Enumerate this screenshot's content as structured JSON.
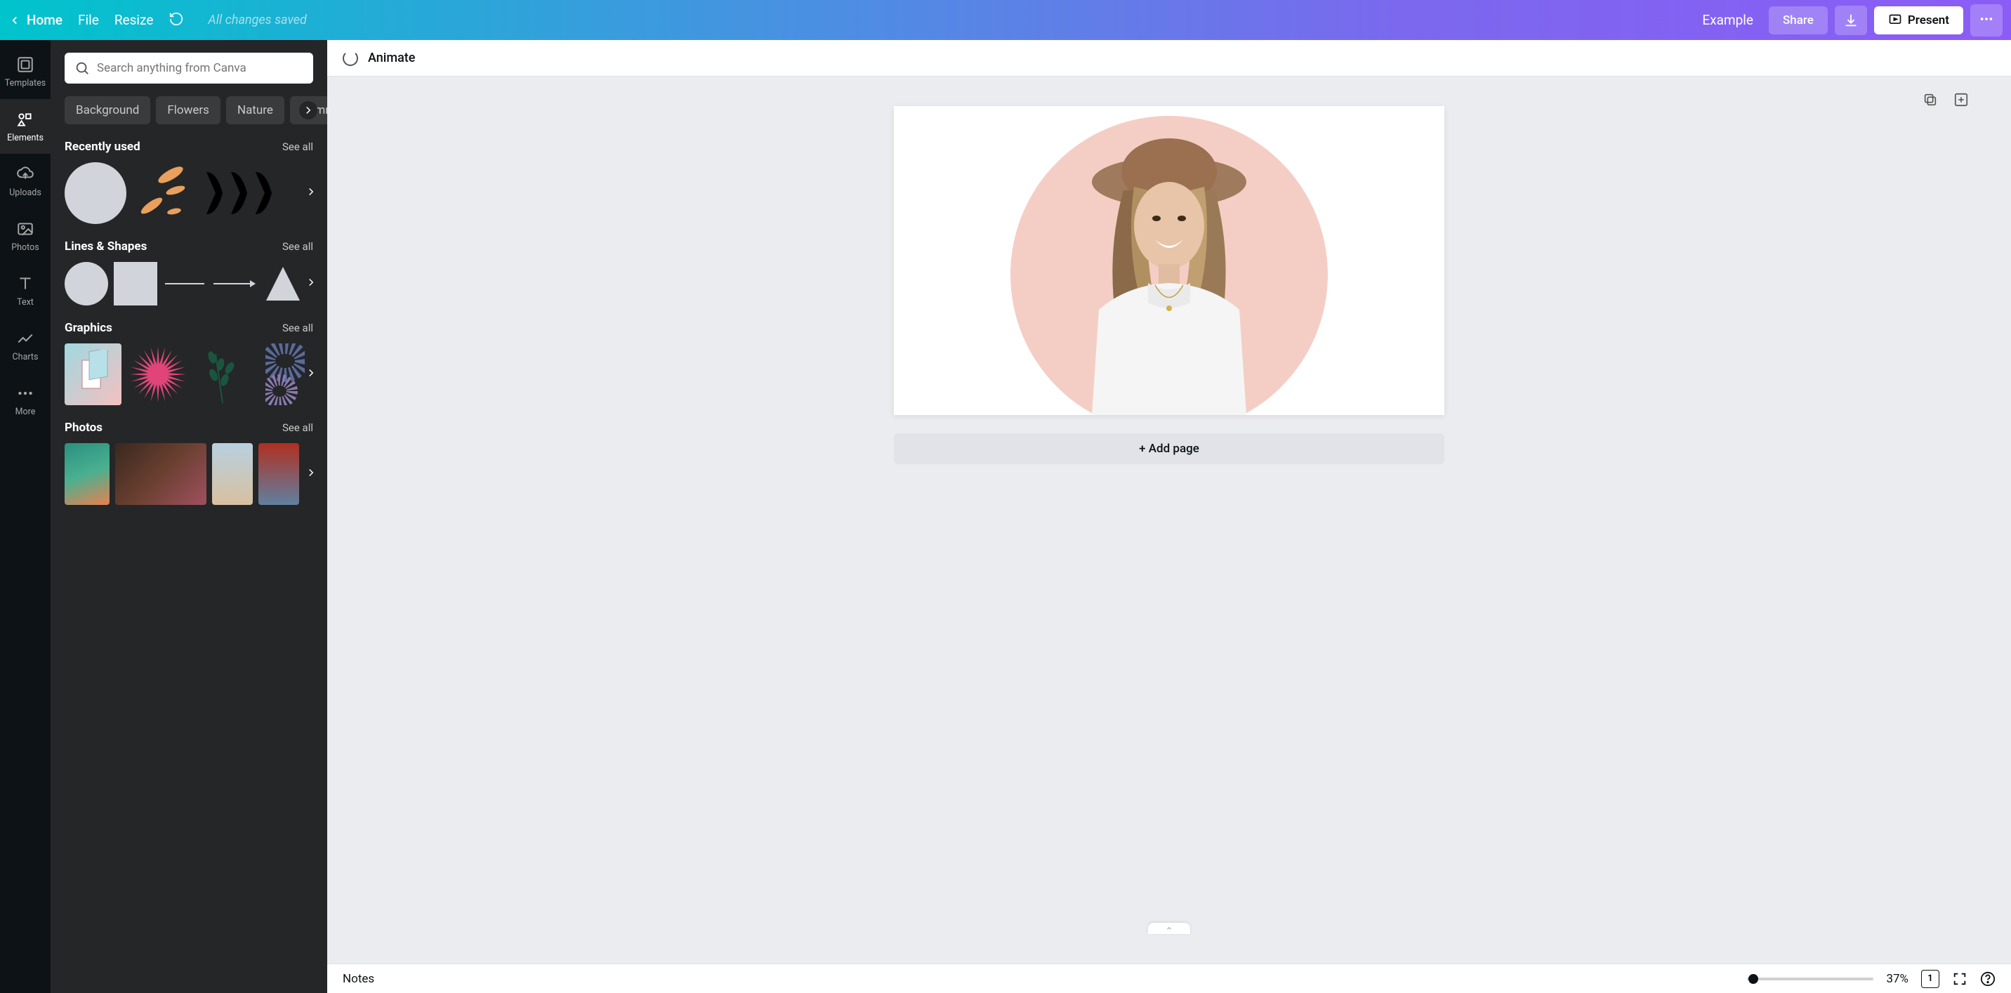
{
  "topbar": {
    "home": "Home",
    "file": "File",
    "resize": "Resize",
    "save_status": "All changes saved",
    "doc_name": "Example",
    "share": "Share",
    "present": "Present"
  },
  "rail": {
    "templates": "Templates",
    "elements": "Elements",
    "uploads": "Uploads",
    "photos": "Photos",
    "text": "Text",
    "charts": "Charts",
    "more": "More"
  },
  "panel": {
    "search_placeholder": "Search anything from Canva",
    "chips": [
      "Background",
      "Flowers",
      "Nature",
      "Summer"
    ],
    "see_all": "See all",
    "sections": {
      "recently_used": "Recently used",
      "lines_shapes": "Lines & Shapes",
      "graphics": "Graphics",
      "photos": "Photos"
    }
  },
  "canvas": {
    "animate": "Animate",
    "add_page": "+ Add page",
    "accent_color": "#f4cec4"
  },
  "bottombar": {
    "notes": "Notes",
    "zoom_pct": "37%",
    "page_count": "1"
  }
}
